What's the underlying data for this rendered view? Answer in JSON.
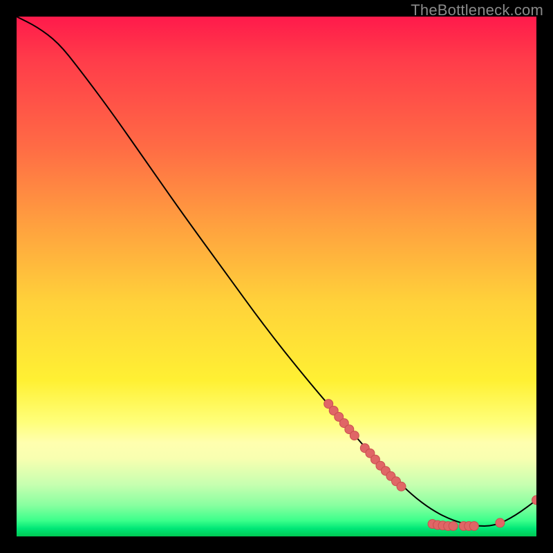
{
  "watermark": "TheBottleneck.com",
  "colors": {
    "curve_stroke": "#000000",
    "marker_fill": "#e06666",
    "marker_stroke": "#c94f4f"
  },
  "chart_data": {
    "type": "line",
    "title": "",
    "xlabel": "",
    "ylabel": "",
    "xlim": [
      0,
      100
    ],
    "ylim": [
      0,
      100
    ],
    "series": [
      {
        "name": "curve",
        "x": [
          0,
          4,
          8,
          12,
          18,
          25,
          32,
          40,
          48,
          56,
          62,
          68,
          72,
          76,
          80,
          84,
          88,
          92,
          96,
          100
        ],
        "y": [
          100,
          98,
          95,
          90,
          82,
          72,
          62,
          51,
          40,
          30,
          23,
          16,
          12,
          8,
          5,
          3,
          2,
          2,
          4,
          7
        ]
      }
    ],
    "markers": [
      {
        "name": "dense-cluster-1",
        "x": 60,
        "y": 25.5
      },
      {
        "name": "dense-cluster-1",
        "x": 61,
        "y": 24.2
      },
      {
        "name": "dense-cluster-1",
        "x": 62,
        "y": 23.0
      },
      {
        "name": "dense-cluster-1",
        "x": 63,
        "y": 21.8
      },
      {
        "name": "dense-cluster-1",
        "x": 64,
        "y": 20.6
      },
      {
        "name": "dense-cluster-1",
        "x": 65,
        "y": 19.4
      },
      {
        "name": "sparse-1",
        "x": 67,
        "y": 17.0
      },
      {
        "name": "sparse-1",
        "x": 68,
        "y": 16.0
      },
      {
        "name": "dense-cluster-2",
        "x": 69,
        "y": 14.8
      },
      {
        "name": "dense-cluster-2",
        "x": 70,
        "y": 13.6
      },
      {
        "name": "dense-cluster-2",
        "x": 71,
        "y": 12.6
      },
      {
        "name": "dense-cluster-2",
        "x": 72,
        "y": 11.6
      },
      {
        "name": "dense-cluster-2",
        "x": 73,
        "y": 10.6
      },
      {
        "name": "dense-cluster-2",
        "x": 74,
        "y": 9.6
      },
      {
        "name": "bottom-cluster",
        "x": 80,
        "y": 2.4
      },
      {
        "name": "bottom-cluster",
        "x": 81,
        "y": 2.2
      },
      {
        "name": "bottom-cluster",
        "x": 82,
        "y": 2.1
      },
      {
        "name": "bottom-cluster",
        "x": 83,
        "y": 2.0
      },
      {
        "name": "bottom-cluster",
        "x": 84,
        "y": 2.0
      },
      {
        "name": "bottom-cluster",
        "x": 86,
        "y": 2.0
      },
      {
        "name": "bottom-cluster",
        "x": 87,
        "y": 2.0
      },
      {
        "name": "bottom-cluster",
        "x": 88,
        "y": 2.0
      },
      {
        "name": "bottom-right",
        "x": 93,
        "y": 2.6
      },
      {
        "name": "end-point",
        "x": 100,
        "y": 7.0
      }
    ]
  }
}
